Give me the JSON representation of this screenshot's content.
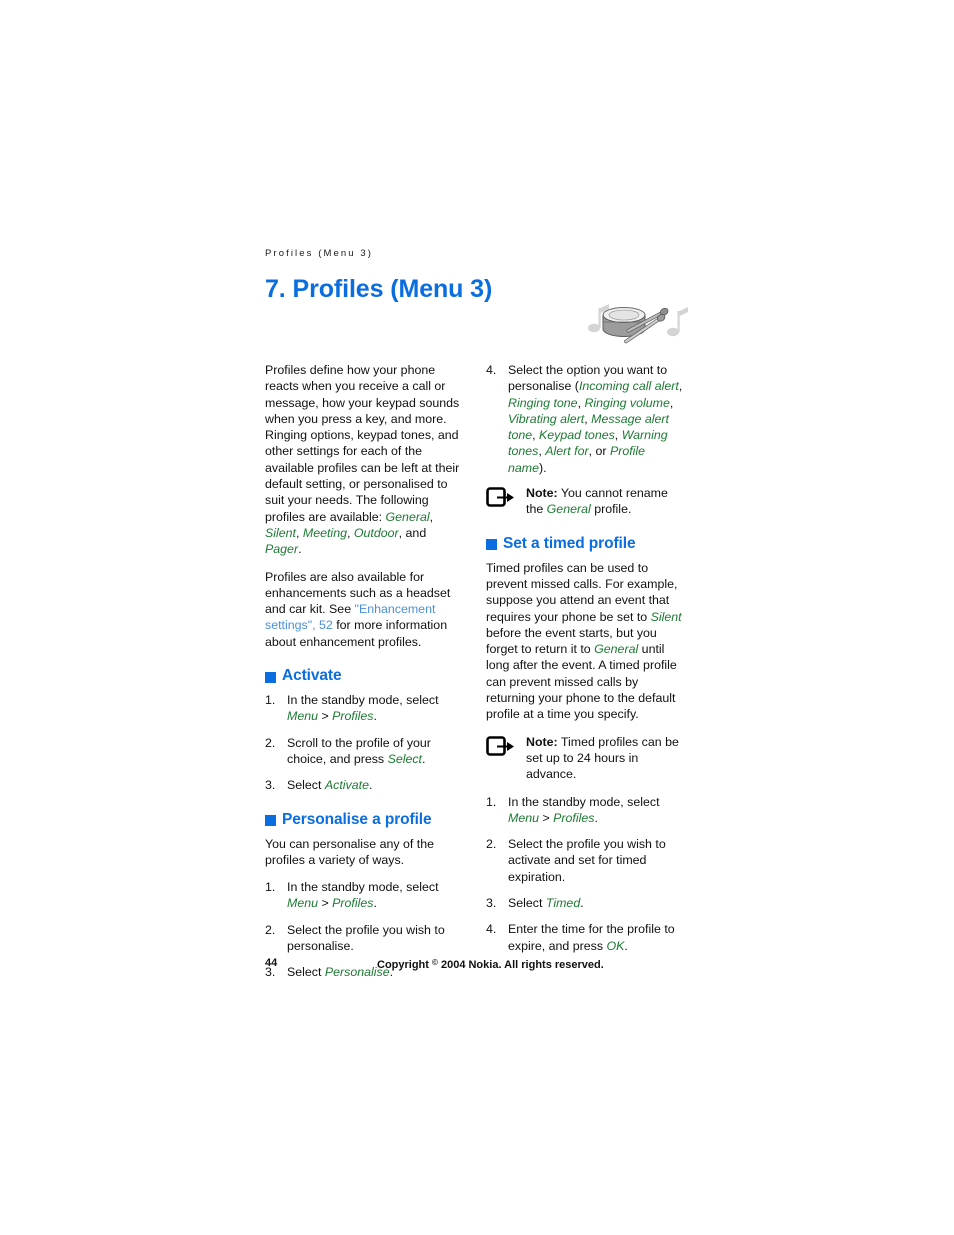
{
  "running_header": "Profiles (Menu 3)",
  "chapter_title": "7. Profiles (Menu 3)",
  "chapter_art_name": "drum-and-drumsticks-illustration",
  "colors": {
    "heading_blue": "#0a6ee0",
    "link_blue": "#4a90d9",
    "emphasis_green": "#1d7a33",
    "body_black": "#111111"
  },
  "left_column": {
    "intro_paragraph": {
      "part1": "Profiles define how your phone reacts when you receive a call or message, how your keypad sounds when you press a key, and more. Ringing options, keypad tones, and other settings for each of the available profiles can be left at their default setting, or personalised to suit your needs. The following profiles are available: ",
      "profile_1": "General",
      "sep_1": ", ",
      "profile_2": "Silent",
      "sep_2": ", ",
      "profile_3": "Meeting",
      "sep_3": ", ",
      "profile_4": "Outdoor",
      "sep_4": ", and ",
      "profile_5": "Pager",
      "end": "."
    },
    "enhancements_paragraph": {
      "part1": "Profiles are also available for enhancements such as a headset and car kit. See ",
      "link": "\"Enhancement settings\", 52",
      "part2": " for more information about enhancement profiles."
    },
    "activate_section": {
      "title": "Activate",
      "steps": [
        {
          "num": "1.",
          "part1": "In the standby mode, select ",
          "em1": "Menu",
          "mid": " > ",
          "em2": "Profiles",
          "part2": "."
        },
        {
          "num": "2.",
          "part1": "Scroll to the profile of your choice, and press ",
          "em1": "Select",
          "part2": "."
        },
        {
          "num": "3.",
          "part1": "Select ",
          "em1": "Activate",
          "part2": "."
        }
      ]
    },
    "personalise_section": {
      "title": "Personalise a profile",
      "intro": "You can personalise any of the profiles a variety of ways.",
      "steps": [
        {
          "num": "1.",
          "part1": "In the standby mode, select ",
          "em1": "Menu",
          "mid": " > ",
          "em2": "Profiles",
          "part2": "."
        },
        {
          "num": "2.",
          "part1": "Select the profile you wish to personalise.",
          "em1": "",
          "part2": ""
        },
        {
          "num": "3.",
          "part1": "Select ",
          "em1": "Personalise",
          "part2": "."
        }
      ]
    }
  },
  "right_column": {
    "step4": {
      "num": "4.",
      "part1": "Select the option you want to personalise (",
      "options": [
        "Incoming call alert",
        "Ringing tone",
        "Ringing volume",
        "Vibrating alert",
        "Message alert tone",
        "Keypad tones",
        "Warning tones",
        "Alert for"
      ],
      "or_word": ", or ",
      "last_option": "Profile name",
      "closing": ")."
    },
    "note_1": {
      "icon": "note-pointer-icon",
      "label": "Note:",
      "part1": " You cannot rename the ",
      "em1": "General",
      "part2": " profile."
    },
    "timed_section": {
      "title": "Set a timed profile",
      "paragraph": {
        "part1": "Timed profiles can be used to prevent missed calls. For example, suppose you attend an event that requires your phone be set to ",
        "em1": "Silent",
        "part2": " before the event starts, but you forget to return it to ",
        "em2": "General",
        "part3": " until long after the event. A timed profile can prevent missed calls by returning your phone to the default profile at a time you specify."
      },
      "note_2": {
        "icon": "note-pointer-icon",
        "label": "Note:",
        "part1": " Timed profiles can be set up to 24 hours in advance."
      },
      "steps": [
        {
          "num": "1.",
          "part1": "In the standby mode, select ",
          "em1": "Menu",
          "mid": " > ",
          "em2": "Profiles",
          "part2": "."
        },
        {
          "num": "2.",
          "part1": "Select the profile you wish to activate and set for timed expiration.",
          "em1": "",
          "part2": ""
        },
        {
          "num": "3.",
          "part1": "Select ",
          "em1": "Timed",
          "part2": "."
        },
        {
          "num": "4.",
          "part1": "Enter the time for the profile to expire, and press ",
          "em1": "OK",
          "part2": "."
        }
      ]
    }
  },
  "footer": {
    "page_number": "44",
    "copyright_pre": "Copyright ",
    "copyright_symbol": "©",
    "copyright_post": " 2004 Nokia. All rights reserved."
  }
}
